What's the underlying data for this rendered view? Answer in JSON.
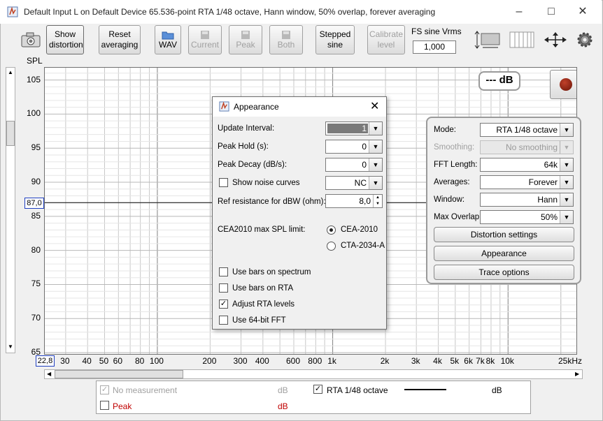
{
  "window": {
    "title": "Default Input L on Default Device 65.536-point RTA 1/48 octave, Hann window, 50% overlap, forever averaging",
    "min_icon": "minimize-icon",
    "max_icon": "maximize-icon",
    "close_icon": "close-icon"
  },
  "toolbar": {
    "show_distortion": "Show distortion",
    "reset_averaging": "Reset averaging",
    "wav": "WAV",
    "current": "Current",
    "peak": "Peak",
    "both": "Both",
    "stepped_sine": "Stepped sine",
    "calibrate_level": "Calibrate level",
    "fs_sine_label": "FS sine Vrms",
    "fs_sine_value": "1,000"
  },
  "plot": {
    "y_axis_label": "SPL",
    "db_readout": "--- dB",
    "y_ticks": [
      "105",
      "100",
      "95",
      "90",
      "85",
      "80",
      "75",
      "70",
      "65"
    ],
    "x_ticks": [
      "30",
      "40",
      "50",
      "60",
      "80",
      "100",
      "200",
      "300",
      "400",
      "600",
      "800",
      "1k",
      "2k",
      "3k",
      "4k",
      "5k",
      "6k",
      "7k",
      "8k",
      "10k",
      "25kHz"
    ],
    "cursor_y": "87,0",
    "cursor_x": "22,8"
  },
  "side_panel": {
    "mode_label": "Mode:",
    "mode_value": "RTA 1/48 octave",
    "smoothing_label": "Smoothing:",
    "smoothing_value": "No  smoothing",
    "fft_label": "FFT Length:",
    "fft_value": "64k",
    "averages_label": "Averages:",
    "averages_value": "Forever",
    "window_label": "Window:",
    "window_value": "Hann",
    "overlap_label": "Max Overlap:",
    "overlap_value": "50%",
    "distortion_settings": "Distortion settings",
    "appearance": "Appearance",
    "trace_options": "Trace options"
  },
  "dialog": {
    "title": "Appearance",
    "update_interval_label": "Update Interval:",
    "update_interval_value": "1",
    "peak_hold_label": "Peak Hold (s):",
    "peak_hold_value": "0",
    "peak_decay_label": "Peak Decay (dB/s):",
    "peak_decay_value": "0",
    "show_noise_label": "Show noise curves",
    "noise_value": "NC",
    "ref_res_label": "Ref resistance for dBW (ohm):",
    "ref_res_value": "8,0",
    "cea_label": "CEA2010 max SPL limit:",
    "cea_2010": "CEA-2010",
    "cta_2034": "CTA-2034-A",
    "bars_spectrum": "Use bars on spectrum",
    "bars_rta": "Use bars on RTA",
    "adjust_rta": "Adjust RTA levels",
    "use_64": "Use 64-bit FFT"
  },
  "legend": {
    "no_measurement": "No measurement",
    "no_measurement_unit": "dB",
    "rta": "RTA 1/48 octave",
    "rta_unit": "dB",
    "peak": "Peak",
    "peak_unit": "dB"
  },
  "colors": {
    "peak": "#c00000",
    "cursor_box": "#1f3fbf",
    "record": "#8b1a10"
  }
}
